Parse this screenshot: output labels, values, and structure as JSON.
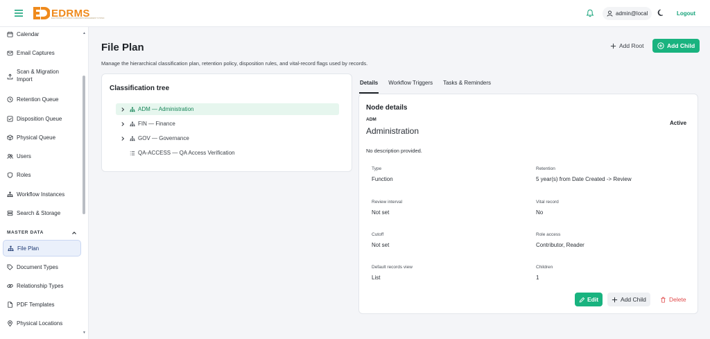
{
  "brand": {
    "name": "EDRMS",
    "tagline": "ELECTRONIC DOCUMENT & RECORDS MANAGEMENT SYSTEM",
    "accent": "#ef8a1c"
  },
  "header": {
    "user": "admin@local",
    "logout_label": "Logout"
  },
  "sidebar": {
    "items": [
      {
        "label": "Calendar",
        "icon": "calendar-icon"
      },
      {
        "label": "Email Captures",
        "icon": "envelope-icon"
      },
      {
        "label": "Scan & Migration Import",
        "icon": "upload-icon"
      },
      {
        "label": "Retention Queue",
        "icon": "clock-icon"
      },
      {
        "label": "Disposition Queue",
        "icon": "checkbox-icon"
      },
      {
        "label": "Physical Queue",
        "icon": "box-icon"
      },
      {
        "label": "Users",
        "icon": "users-icon"
      },
      {
        "label": "Roles",
        "icon": "shield-icon"
      },
      {
        "label": "Workflow Instances",
        "icon": "hierarchy-icon"
      },
      {
        "label": "Search & Storage",
        "icon": "database-icon"
      }
    ],
    "section_title": "MASTER DATA",
    "master_items": [
      {
        "label": "File Plan",
        "icon": "hierarchy-icon",
        "active": true
      },
      {
        "label": "Document Types",
        "icon": "tag-icon"
      },
      {
        "label": "Relationship Types",
        "icon": "link-icon"
      },
      {
        "label": "PDF Templates",
        "icon": "file-icon"
      },
      {
        "label": "Physical Locations",
        "icon": "pin-icon"
      }
    ]
  },
  "page": {
    "title": "File Plan",
    "description": "Manage the hierarchical classification plan, retention policy, disposition rules, and vital-record flags used by records.",
    "add_root_label": "Add Root",
    "add_child_label": "Add Child"
  },
  "tree": {
    "title": "Classification tree",
    "nodes": [
      {
        "label": "ADM — Administration",
        "expandable": true,
        "selected": true
      },
      {
        "label": "FIN — Finance",
        "expandable": true,
        "selected": false
      },
      {
        "label": "GOV — Governance",
        "expandable": true,
        "selected": false
      },
      {
        "label": "QA-ACCESS — QA Access Verification",
        "expandable": false,
        "selected": false
      }
    ]
  },
  "tabs": [
    "Details",
    "Workflow Triggers",
    "Tasks & Reminders"
  ],
  "node_details": {
    "title": "Node details",
    "code": "ADM",
    "name": "Administration",
    "status": "Active",
    "description": "No description provided.",
    "fields": [
      {
        "label": "Type",
        "value": "Function"
      },
      {
        "label": "Retention",
        "value": "5 year(s) from Date Created -> Review"
      },
      {
        "label": "Review interval",
        "value": "Not set"
      },
      {
        "label": "Vital record",
        "value": "No"
      },
      {
        "label": "Cutoff",
        "value": "Not set"
      },
      {
        "label": "Role access",
        "value": "Contributor, Reader"
      },
      {
        "label": "Default records view",
        "value": "List"
      },
      {
        "label": "Children",
        "value": "1"
      }
    ],
    "edit_label": "Edit",
    "add_child_label": "Add Child",
    "delete_label": "Delete"
  },
  "colors": {
    "primary": "#19b37f",
    "danger": "#e04b4b",
    "selected_bg": "#e6f6ee"
  }
}
